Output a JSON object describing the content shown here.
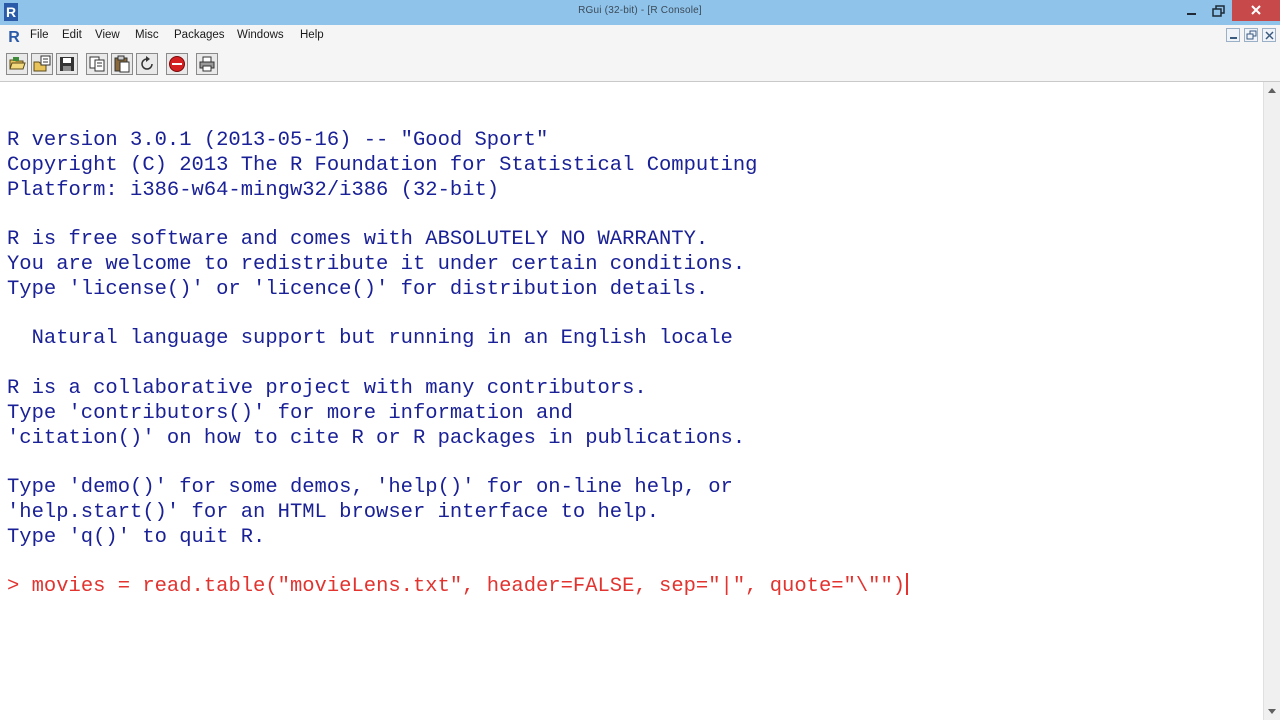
{
  "window": {
    "title": "RGui (32-bit) - [R Console]"
  },
  "menu": {
    "items": [
      "File",
      "Edit",
      "View",
      "Misc",
      "Packages",
      "Windows",
      "Help"
    ]
  },
  "toolbar": {
    "buttons": [
      "open-script",
      "load-workspace",
      "save-workspace",
      "copy",
      "paste",
      "copy-paste",
      "stop",
      "print"
    ]
  },
  "console": {
    "lines": [
      "R version 3.0.1 (2013-05-16) -- \"Good Sport\"",
      "Copyright (C) 2013 The R Foundation for Statistical Computing",
      "Platform: i386-w64-mingw32/i386 (32-bit)",
      "",
      "R is free software and comes with ABSOLUTELY NO WARRANTY.",
      "You are welcome to redistribute it under certain conditions.",
      "Type 'license()' or 'licence()' for distribution details.",
      "",
      "  Natural language support but running in an English locale",
      "",
      "R is a collaborative project with many contributors.",
      "Type 'contributors()' for more information and",
      "'citation()' on how to cite R or R packages in publications.",
      "",
      "Type 'demo()' for some demos, 'help()' for on-line help, or",
      "'help.start()' for an HTML browser interface to help.",
      "Type 'q()' to quit R.",
      ""
    ],
    "prompt": "> ",
    "input": "movies = read.table(\"movieLens.txt\", header=FALSE, sep=\"|\", quote=\"\\\"\")"
  },
  "colors": {
    "output": "#1a2196",
    "input": "#e2332f",
    "titlebar": "#8fc3ea"
  }
}
